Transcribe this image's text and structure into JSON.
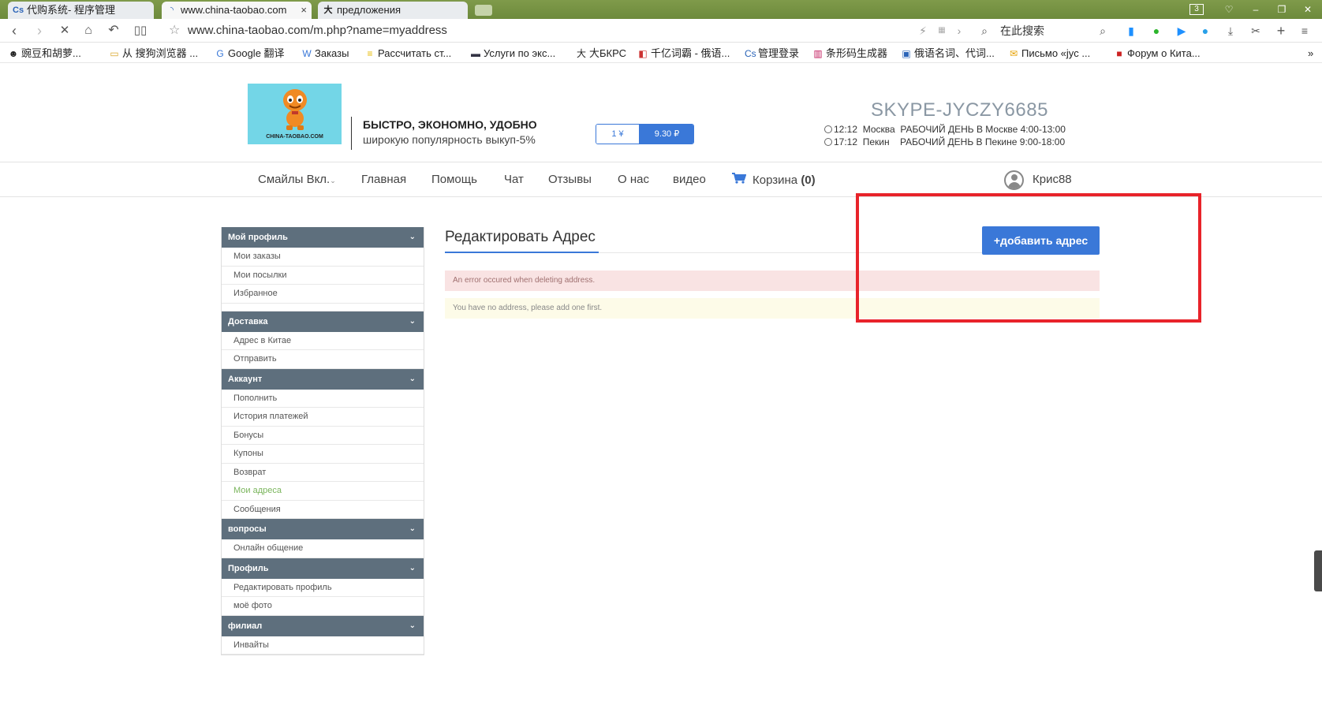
{
  "browser": {
    "tabs": [
      {
        "label": "代购系统- 程序管理",
        "icon": "cs-logo-icon"
      },
      {
        "label": "www.china-taobao.com",
        "icon": "loading-icon",
        "active": true
      },
      {
        "label": "предложения",
        "icon": "bkrs-icon"
      }
    ],
    "tab_count": "3",
    "close_glyph": "×",
    "url": "www.china-taobao.com/m.php?name=myaddress",
    "search_placeholder": "在此搜索",
    "bookmarks": [
      "豌豆和胡萝...",
      "从 搜狗浏览器 ...",
      "Google 翻译",
      "Заказы",
      "Рассчитать ст...",
      "Услуги по экс...",
      "大БКРС",
      "千亿词霸 - 俄语...",
      "管理登录",
      "条形码生成器",
      "俄语名词、代词...",
      "Письмо «jyc ...",
      "Форум о Кита..."
    ],
    "more_glyph": "»"
  },
  "header": {
    "logo_text": "CHINA-TAOBAO.COM",
    "slogan_title": "БЫСТРО, ЭКОНОМНО, УДОБНО",
    "slogan_sub": "широкую популярность выкуп-5%",
    "rate_left": "1 ¥",
    "rate_right": "9.30 ₽",
    "skype": "SKYPE-JYCZY6685",
    "clocks": [
      {
        "time": "12:12",
        "city": "Москва",
        "hours": "РАБОЧИЙ ДЕНЬ В Москве 4:00-13:00"
      },
      {
        "time": "17:12",
        "city": "Пекин",
        "hours": "РАБОЧИЙ ДЕНЬ В Пекине 9:00-18:00"
      }
    ]
  },
  "nav": {
    "smiles": "Смайлы Вкл.",
    "home": "Главная",
    "help": "Помощь",
    "chat": "Чат",
    "reviews": "Отзывы",
    "about": "О нас",
    "video": "видео",
    "cart_label": "Корзина",
    "cart_count": "(0)",
    "username": "Крис88"
  },
  "sidebar": {
    "sections": [
      {
        "title": "Мой профиль",
        "items": [
          "Мои заказы",
          "Мои посылки",
          "Избранное"
        ]
      },
      {
        "title": "Доставка",
        "items": [
          "Адрес в Китае",
          "Отправить"
        ]
      },
      {
        "title": "Аккаунт",
        "items": [
          "Пополнить",
          "История платежей",
          "Бонусы",
          "Купоны",
          "Возврат",
          "Мои адреса",
          "Сообщения"
        ]
      },
      {
        "title": "вопросы",
        "items": [
          "Онлайн общение"
        ]
      },
      {
        "title": "Профиль",
        "items": [
          "Редактировать профиль",
          "моё фото"
        ]
      },
      {
        "title": "филиал",
        "items": [
          "Инвайты"
        ]
      }
    ],
    "active_item": "Мои адреса"
  },
  "content": {
    "title": "Редактировать Адрес",
    "add_button": "+добавить адрес",
    "error_message": "An error occured when deleting address.",
    "info_message": "You have no address, please add one first."
  },
  "colors": {
    "accent": "#3a78d8",
    "sidebar_header": "#5e6f7d",
    "active_link": "#7ab55c",
    "highlight": "#e8232a",
    "tabbar": "#7f9a4a"
  }
}
